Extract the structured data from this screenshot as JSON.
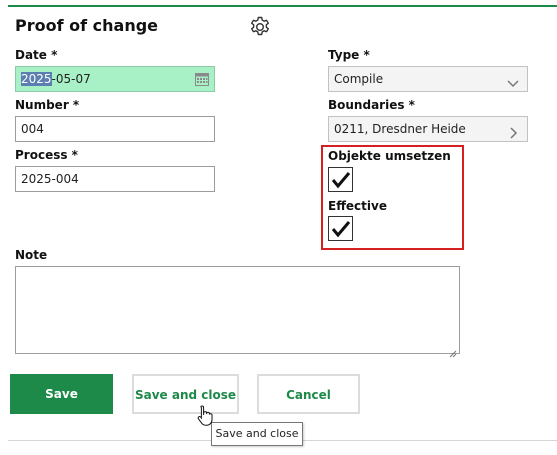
{
  "header": {
    "title": "Proof of change",
    "settings_icon": "gear-icon"
  },
  "form": {
    "date": {
      "label": "Date *",
      "value_selected": "2025",
      "value_rest": "-05-07",
      "icon": "calendar-icon"
    },
    "type": {
      "label": "Type *",
      "value": "Compile",
      "icon": "chevron-down-icon"
    },
    "number": {
      "label": "Number *",
      "value": "004"
    },
    "boundaries": {
      "label": "Boundaries *",
      "value": "0211, Dresdner Heide",
      "icon": "chevron-right-icon"
    },
    "process": {
      "label": "Process *",
      "value": "2025-004"
    },
    "objekte_umsetzen": {
      "label": "Objekte umsetzen",
      "checked": true
    },
    "effective": {
      "label": "Effective",
      "checked": true
    },
    "note": {
      "label": "Note",
      "value": ""
    }
  },
  "actions": {
    "save_label": "Save",
    "save_close_label": "Save and close",
    "cancel_label": "Cancel"
  },
  "tooltip": {
    "text": "Save and close"
  },
  "colors": {
    "accent": "#1e8a4a",
    "date_field_bg": "#a8f0c6",
    "highlight_border": "#d42020",
    "selection_bg": "#5b7fb0"
  }
}
